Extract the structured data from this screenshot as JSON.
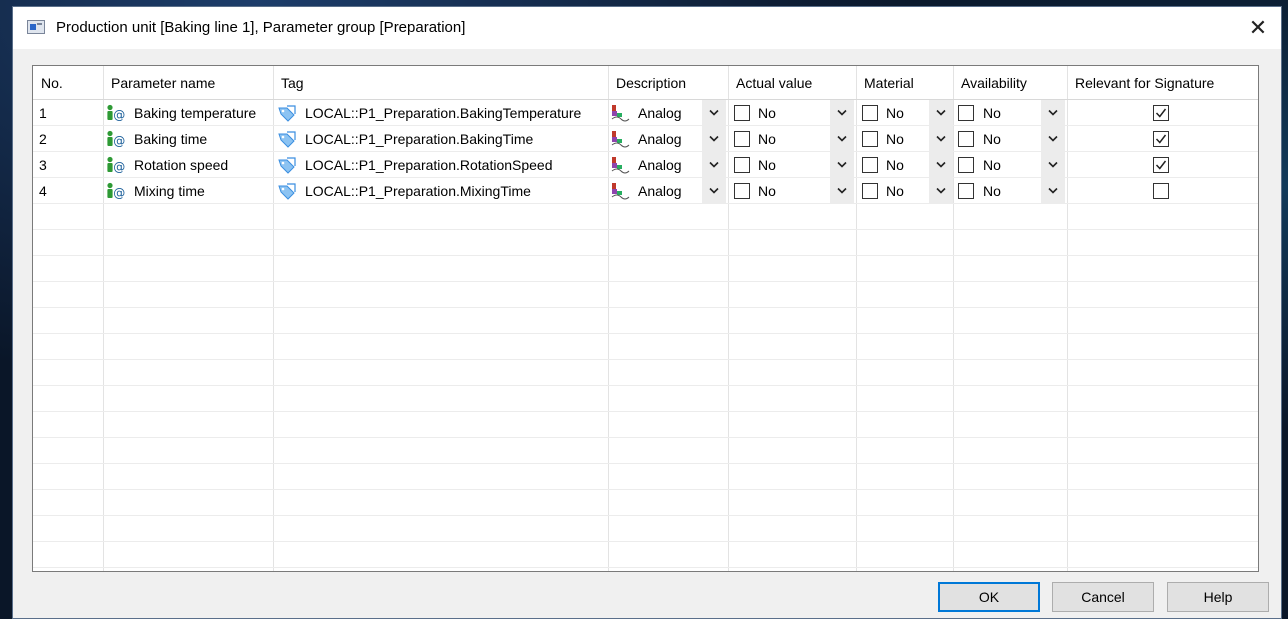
{
  "window": {
    "title": "Production unit [Baking line 1], Parameter group [Preparation]",
    "close_glyph": "✕"
  },
  "columns": [
    "No.",
    "Parameter name",
    "Tag",
    "Description",
    "Actual value",
    "Material",
    "Availability",
    "Relevant for Signature"
  ],
  "rows": [
    {
      "no": "1",
      "name": "Baking temperature",
      "tag": "LOCAL::P1_Preparation.BakingTemperature",
      "description": "Analog",
      "actual_value": "No",
      "material": "No",
      "availability": "No",
      "relevant": true
    },
    {
      "no": "2",
      "name": "Baking time",
      "tag": "LOCAL::P1_Preparation.BakingTime",
      "description": "Analog",
      "actual_value": "No",
      "material": "No",
      "availability": "No",
      "relevant": true
    },
    {
      "no": "3",
      "name": "Rotation speed",
      "tag": "LOCAL::P1_Preparation.RotationSpeed",
      "description": "Analog",
      "actual_value": "No",
      "material": "No",
      "availability": "No",
      "relevant": true
    },
    {
      "no": "4",
      "name": "Mixing time",
      "tag": "LOCAL::P1_Preparation.MixingTime",
      "description": "Analog",
      "actual_value": "No",
      "material": "No",
      "availability": "No",
      "relevant": false
    }
  ],
  "buttons": {
    "ok": "OK",
    "cancel": "Cancel",
    "help": "Help"
  },
  "icons": {
    "parameter": "parameter-icon",
    "tag": "tag-icon",
    "description": "analog-icon",
    "dropdown": "chevron-down-icon"
  },
  "colors": {
    "accent": "#0078d7",
    "param_icon_green": "#2e9a35",
    "tag_icon_blue": "#3a8ee0"
  }
}
